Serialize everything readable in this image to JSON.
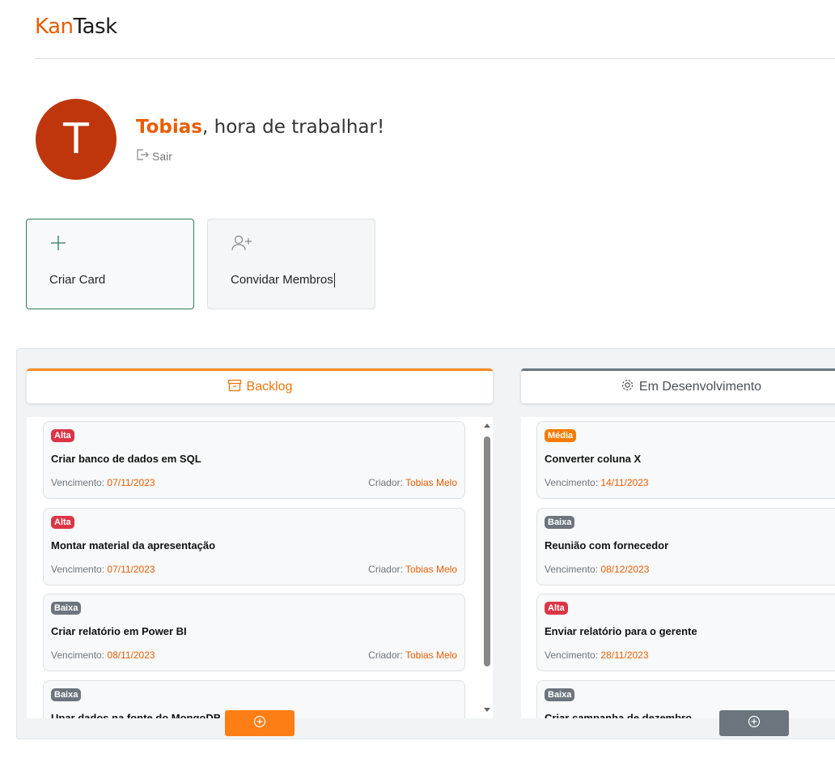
{
  "brand": {
    "part1": "Kan",
    "part2": "Task"
  },
  "user": {
    "initial": "T",
    "name": "Tobias",
    "greeting_rest": ", hora de trabalhar!",
    "logout_label": "Sair"
  },
  "actions": {
    "create_card": "Criar Card",
    "invite_members": "Convidar Membros"
  },
  "columns": [
    {
      "title": "Backlog",
      "cards": [
        {
          "priority": "Alta",
          "title": "Criar banco de dados em SQL",
          "due_label": "Vencimento:",
          "due": "07/11/2023",
          "creator_label": "Criador:",
          "creator": "Tobias Melo"
        },
        {
          "priority": "Alta",
          "title": "Montar material da apresentação",
          "due_label": "Vencimento:",
          "due": "07/11/2023",
          "creator_label": "Criador:",
          "creator": "Tobias Melo"
        },
        {
          "priority": "Baixa",
          "title": "Criar relatório em Power BI",
          "due_label": "Vencimento:",
          "due": "08/11/2023",
          "creator_label": "Criador:",
          "creator": "Tobias Melo"
        },
        {
          "priority": "Baixa",
          "title": "Upar dados na fonte do MongoDB"
        }
      ]
    },
    {
      "title": "Em Desenvolvimento",
      "cards": [
        {
          "priority": "Média",
          "title": "Converter coluna X",
          "due_label": "Vencimento:",
          "due": "14/11/2023"
        },
        {
          "priority": "Baixa",
          "title": "Reunião com fornecedor",
          "due_label": "Vencimento:",
          "due": "08/12/2023"
        },
        {
          "priority": "Alta",
          "title": "Enviar relatório para o gerente",
          "due_label": "Vencimento:",
          "due": "28/11/2023"
        },
        {
          "priority": "Baixa",
          "title": "Criar campanha de dezembro"
        }
      ]
    }
  ],
  "colors": {
    "accent": "#e85d04",
    "alta": "#dc3545",
    "baixa": "#6c757d",
    "media": "#f57c00"
  }
}
